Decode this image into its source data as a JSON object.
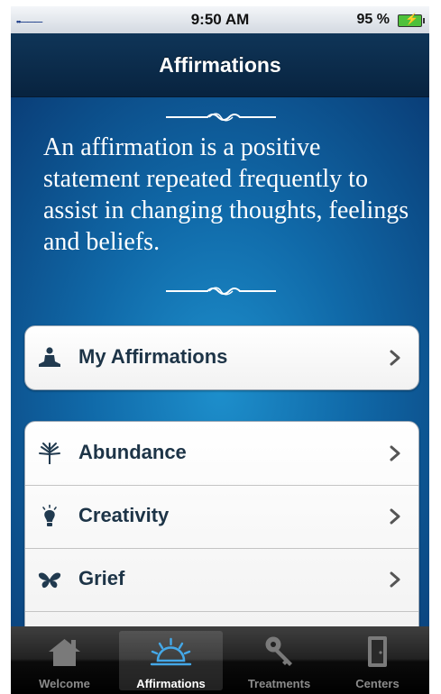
{
  "status_bar": {
    "time": "9:50 AM",
    "battery": "95 %",
    "signal": "••———"
  },
  "nav": {
    "title": "Affirmations"
  },
  "intro": {
    "text": "An affirmation is a positive statement repeated frequently to assist in changing thoughts, feelings and beliefs."
  },
  "my_group": {
    "items": [
      {
        "label": "My Affirmations",
        "icon": "meditating-person-icon"
      }
    ]
  },
  "categories": {
    "items": [
      {
        "label": "Abundance",
        "icon": "tree-icon"
      },
      {
        "label": "Creativity",
        "icon": "lightbulb-icon"
      },
      {
        "label": "Grief",
        "icon": "butterfly-icon"
      }
    ]
  },
  "tabs": [
    {
      "label": "Welcome",
      "icon": "house-icon",
      "selected": false
    },
    {
      "label": "Affirmations",
      "icon": "sunrise-icon",
      "selected": true
    },
    {
      "label": "Treatments",
      "icon": "key-icon",
      "selected": false
    },
    {
      "label": "Centers",
      "icon": "door-icon",
      "selected": false
    }
  ],
  "colors": {
    "background_blue": "#1069a8",
    "nav_dark": "#08233f",
    "row_text": "#1d3447",
    "tab_inactive": "#8b8b8b"
  }
}
